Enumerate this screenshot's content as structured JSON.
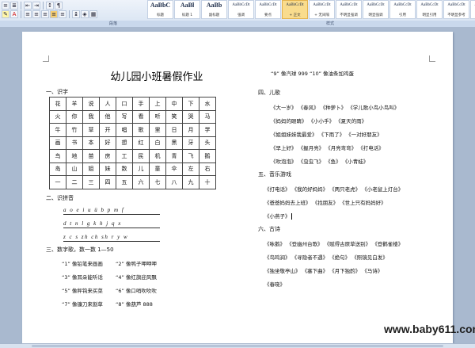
{
  "ribbon": {
    "paragraph_group_label": "段落",
    "styles_group_label": "样式",
    "styles": [
      {
        "sample": "AaBbC",
        "name": "标题"
      },
      {
        "sample": "AaBł",
        "name": "标题 1"
      },
      {
        "sample": "AaBb",
        "name": "副标题"
      },
      {
        "sample": "AaBbCcDt",
        "name": "强调"
      },
      {
        "sample": "AaBbCcDt",
        "name": "要点"
      },
      {
        "sample": "AaBbCcDt",
        "name": "+ 正文"
      },
      {
        "sample": "AaBbCcDt",
        "name": "+ 无间隔"
      },
      {
        "sample": "AaBbCcDt",
        "name": "不明显强调"
      },
      {
        "sample": "AaBbCcDt",
        "name": "明显强调"
      },
      {
        "sample": "AaBbCcDt",
        "name": "引用"
      },
      {
        "sample": "AaBbCcDt",
        "name": "明显引用"
      },
      {
        "sample": "AaBbCcDt",
        "name": "不明显参考"
      },
      {
        "sample": "AaBbCcDt",
        "name": "明显参考"
      }
    ]
  },
  "doc": {
    "title": "幼儿园小班暑假作业",
    "section1": "一、识字",
    "char_grid": [
      [
        "花",
        "羊",
        "说",
        "人",
        "口",
        "手",
        "上",
        "中",
        "下",
        "水"
      ],
      [
        "火",
        "你",
        "我",
        "他",
        "写",
        "看",
        "听",
        "笑",
        "哭",
        "马"
      ],
      [
        "牛",
        "竹",
        "草",
        "开",
        "唱",
        "歌",
        "里",
        "日",
        "月",
        "学"
      ],
      [
        "画",
        "书",
        "本",
        "好",
        "想",
        "红",
        "白",
        "黑",
        "牙",
        "头"
      ],
      [
        "鸟",
        "地",
        "苗",
        "房",
        "工",
        "民",
        "机",
        "青",
        "飞",
        "鹅"
      ],
      [
        "岛",
        "山",
        "姐",
        "妹",
        "数",
        "儿",
        "童",
        "伞",
        "左",
        "右"
      ],
      [
        "一",
        "二",
        "三",
        "四",
        "五",
        "六",
        "七",
        "八",
        "九",
        "十"
      ]
    ],
    "section2": "二、识拼音",
    "pinyin": [
      "a o e i u ü b p m f",
      "d t n l g k h j q x",
      "z c s zh ch sh r y w"
    ],
    "section3": "三、数字歌，数一数 1—50",
    "number_songs": [
      [
        "“1” 像铅笔来画画",
        "“2” 像鸭子呷呷呷"
      ],
      [
        "“3” 像耳朵能听话",
        "“4” 像红旗迎风飘"
      ],
      [
        "“5” 像秤钩来买菜",
        "“6” 像口哨吹吹吹"
      ],
      [
        "“7” 像镰刀来割草",
        "“8” 像葫芦 888"
      ]
    ],
    "number_songs_cont": "“9” 像汽球 999    “10” 像油条加鸡蛋",
    "section4": "四、儿歌",
    "children_songs": [
      "《大一岁》  《春风》   《种萝卜》  《学儿歌小鸟小鸟叫》",
      "《妈妈的眼睛》  《小小手》   《夏天的雨》",
      "《姐姐妹妹我最爱》  《下雨了》  《一对好朋友》",
      "《早上好》  《握月亮》  《月亮弯弯》  《打电话》",
      "《吹泡泡》  《虫虫飞》  《鱼》   《小青蛙》"
    ],
    "section5": "五、音乐游戏",
    "music_games": [
      "《打电话》  《我的好妈妈》  《两只老虎》  《小老鼠上灯台》",
      "《爸爸妈妈去上班》   《找朋友》   《世上只有妈妈好》",
      "《小燕子》"
    ],
    "section6": "六、古诗",
    "poems": [
      "《咏鹅》   《登幽州台歌》   《赋得古原草送别》   《登鹳雀楼》",
      "《鸟鸣涧》   《寻隐者不遇》   《绝句》   《照镜见白发》",
      "《独坐敬亭山》   《塞下曲》   《月下独酌》   《马诗》",
      "《春晓》"
    ]
  },
  "watermark": "www.baby611.com"
}
